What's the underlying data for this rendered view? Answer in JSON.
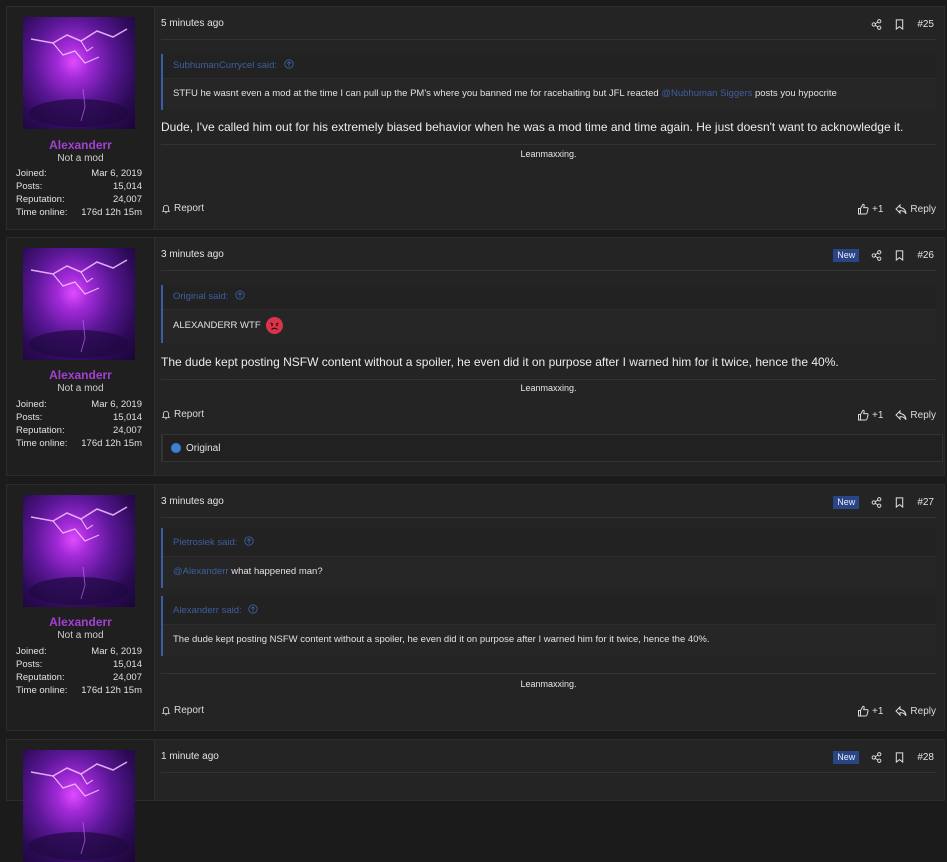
{
  "colors": {
    "background": "#1b1b1b",
    "post_background": "#242424",
    "username": "#a43fd6",
    "quote_accent": "#3a5da3",
    "new_badge": "#2a4585",
    "like_blue": "#3d7ed6"
  },
  "posts": [
    {
      "user": {
        "name": "Alexanderr",
        "title": "Not a mod",
        "stats": [
          {
            "label": "Joined:",
            "value": "Mar 6, 2019"
          },
          {
            "label": "Posts:",
            "value": "15,014"
          },
          {
            "label": "Reputation:",
            "value": "24,007"
          },
          {
            "label": "Time online:",
            "value": "176d 12h 15m"
          }
        ]
      },
      "time": "5 minutes ago",
      "number": "#25",
      "new_badge": "",
      "quotes": [
        {
          "author": "SubhumanCurrycel said:",
          "prefix": "STFU he wasnt even a mod at the time I can pull up the PM's where you banned me for racebaiting but JFL reacted",
          "mention": "@Nubhuman Siggers",
          "suffix": "posts you hypocrite"
        }
      ],
      "content": "Dude, I've called him out for his extremely biased behavior when he was a mod time and time again. He just doesn't want to acknowledge it.",
      "signature": "Leanmaxxing.",
      "report": "Report",
      "likes": "+1",
      "reply": "Reply"
    },
    {
      "user": {
        "name": "Alexanderr",
        "title": "Not a mod",
        "stats": [
          {
            "label": "Joined:",
            "value": "Mar 6, 2019"
          },
          {
            "label": "Posts:",
            "value": "15,014"
          },
          {
            "label": "Reputation:",
            "value": "24,007"
          },
          {
            "label": "Time online:",
            "value": "176d 12h 15m"
          }
        ]
      },
      "time": "3 minutes ago",
      "number": "#26",
      "new_badge": "New",
      "quotes": [
        {
          "author": "Original said:",
          "text": "ALEXANDERR WTF",
          "emoji": "angry-face-emoji"
        }
      ],
      "content": "The dude kept posting NSFW content without a spoiler, he even did it on purpose after I warned him for it twice, hence the 40%.",
      "signature": "Leanmaxxing.",
      "report": "Report",
      "likes": "+1",
      "reply": "Reply",
      "reactions": "Original"
    },
    {
      "user": {
        "name": "Alexanderr",
        "title": "Not a mod",
        "stats": [
          {
            "label": "Joined:",
            "value": "Mar 6, 2019"
          },
          {
            "label": "Posts:",
            "value": "15,014"
          },
          {
            "label": "Reputation:",
            "value": "24,007"
          },
          {
            "label": "Time online:",
            "value": "176d 12h 15m"
          }
        ]
      },
      "time": "3 minutes ago",
      "number": "#27",
      "new_badge": "New",
      "quotes": [
        {
          "author": "Pietrosiek said:",
          "mention": "@Alexanderr",
          "suffix": "what happened man?"
        },
        {
          "author": "Alexanderr said:",
          "text": "The dude kept posting NSFW content without a spoiler, he even did it on purpose after I warned him for it twice, hence the 40%."
        }
      ],
      "signature": "Leanmaxxing.",
      "report": "Report",
      "likes": "+1",
      "reply": "Reply"
    },
    {
      "time": "1 minute ago",
      "number": "#28",
      "new_badge": "New"
    }
  ]
}
